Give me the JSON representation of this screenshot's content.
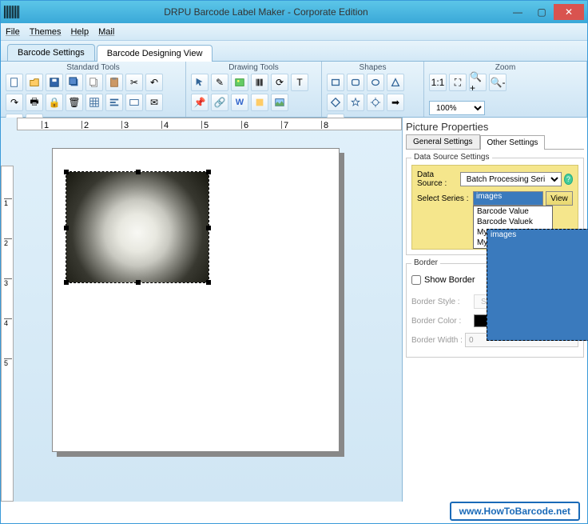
{
  "window": {
    "title": "DRPU Barcode Label Maker - Corporate Edition"
  },
  "menu": {
    "file": "File",
    "themes": "Themes",
    "help": "Help",
    "mail": "Mail"
  },
  "tabs": {
    "settings": "Barcode Settings",
    "designing": "Barcode Designing View"
  },
  "ribbon": {
    "standard": "Standard Tools",
    "drawing": "Drawing Tools",
    "shapes": "Shapes",
    "zoom": "Zoom",
    "zoom_value": "100%"
  },
  "ruler": {
    "marks": [
      "1",
      "2",
      "3",
      "4",
      "5",
      "6",
      "7",
      "8"
    ],
    "vmarks": [
      "1",
      "2",
      "3",
      "4",
      "5"
    ]
  },
  "props": {
    "title": "Picture Properties",
    "tab_general": "General Settings",
    "tab_other": "Other Settings",
    "ds_legend": "Data Source Settings",
    "ds_label": "Data Source :",
    "ds_value": "Batch Processing Seri",
    "series_label": "Select Series :",
    "series_value": "images",
    "view_btn": "View",
    "series_options": [
      "Barcode Value",
      "Barcode Valuek",
      "images",
      "My Header Value",
      "My Product List"
    ],
    "border_legend": "Border",
    "show_border": "Show Border",
    "border_style_label": "Border Style :",
    "border_style_value": "Solid",
    "border_color_label": "Border Color :",
    "border_color_btn": "...",
    "border_width_label": "Border Width :",
    "border_width_value": "0"
  },
  "footer": {
    "link": "www.HowToBarcode.net"
  }
}
